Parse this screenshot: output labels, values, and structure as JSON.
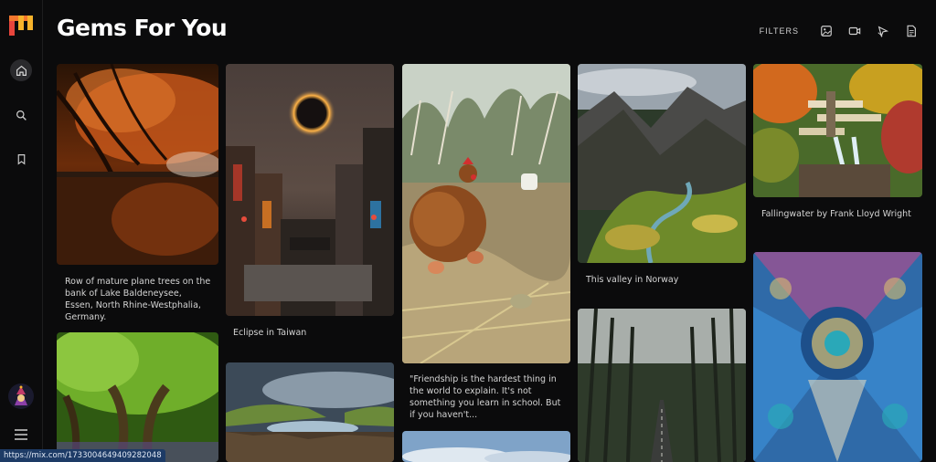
{
  "app": {
    "title": "Gems For You"
  },
  "sidebar": {
    "items": [
      {
        "icon": "home-icon",
        "active": true
      },
      {
        "icon": "search-icon",
        "active": false
      },
      {
        "icon": "bookmark-icon",
        "active": false
      }
    ],
    "menu_icon": "hamburger-menu-icon"
  },
  "toolbar": {
    "filters_label": "FILTERS",
    "icons": [
      "image-icon",
      "video-icon",
      "web-icon",
      "document-icon"
    ]
  },
  "gallery": {
    "captions": {
      "plane_trees": "Row of mature plane trees on the bank of Lake Baldeneysee, Essen, North Rhine-Westphalia, Germany.",
      "eclipse": "Eclipse in Taiwan",
      "friendship": "\"Friendship is the hardest thing in the world to explain. It's not something you learn in school. But if you haven't...",
      "norway": "This valley in Norway",
      "fallingwater": "Fallingwater by Frank Lloyd Wright"
    }
  },
  "status_bar": {
    "url": "https://mix.com/1733004649409282048"
  },
  "colors": {
    "background": "#0b0b0c",
    "status_bar": "#1d3b66",
    "logo_red": "#e8453c",
    "logo_yellow": "#f7b32b"
  }
}
